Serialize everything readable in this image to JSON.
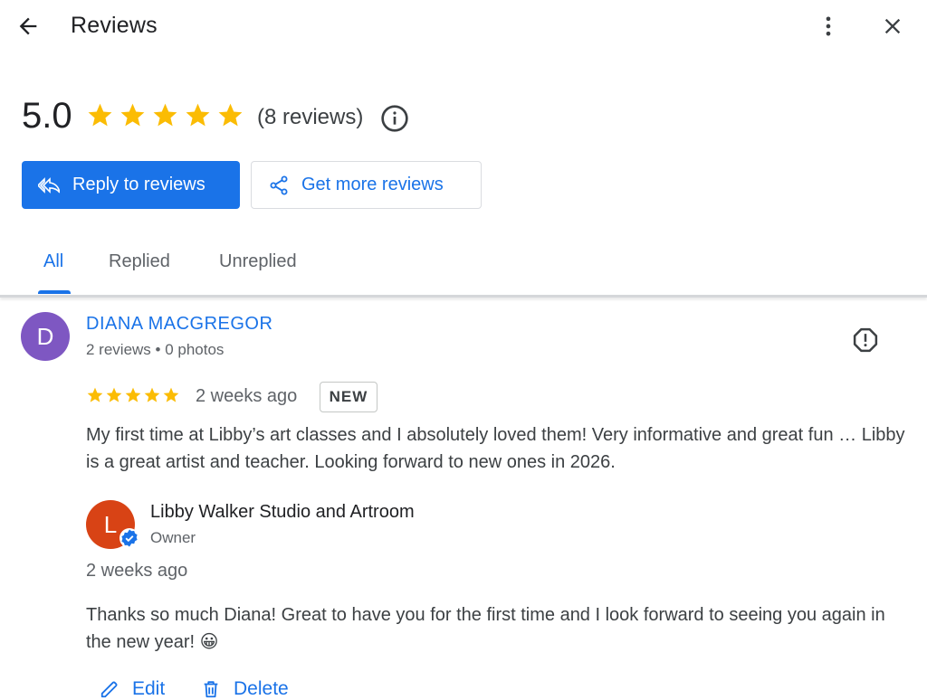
{
  "header": {
    "title": "Reviews",
    "back_icon": "arrow-back-icon",
    "more_icon": "more-vert-icon",
    "close_icon": "close-icon"
  },
  "summary": {
    "rating": "5.0",
    "stars": 5,
    "review_count": "(8 reviews)",
    "info_icon": "info-icon"
  },
  "actions": {
    "reply_label": "Reply to reviews",
    "get_more_label": "Get more reviews"
  },
  "tabs": [
    {
      "label": "All",
      "active": true
    },
    {
      "label": "Replied",
      "active": false
    },
    {
      "label": "Unreplied",
      "active": false
    }
  ],
  "review": {
    "avatar_letter": "D",
    "avatar_color": "#7e57c2",
    "reviewer_name": "DIANA MACGREGOR",
    "reviewer_meta": "2 reviews • 0 photos",
    "stars": 5,
    "age": "2 weeks ago",
    "badge": "NEW",
    "text": "My first time at Libby’s art classes and I absolutely loved them! Very informative and great fun … Libby is a great artist and teacher. Looking forward to new ones in 2026.",
    "report_icon": "report-icon"
  },
  "reply": {
    "avatar_letter": "L",
    "avatar_color": "#d84315",
    "owner_name": "Libby Walker Studio and Artroom",
    "owner_role": "Owner",
    "age": "2 weeks ago",
    "text": "Thanks so much Diana! Great to have you for the first time and I look forward to seeing you again in the new year! 😀",
    "edit_label": "Edit",
    "delete_label": "Delete"
  },
  "colors": {
    "accent": "#1a73e8",
    "star": "#fbbc04",
    "verified": "#1a73e8"
  }
}
